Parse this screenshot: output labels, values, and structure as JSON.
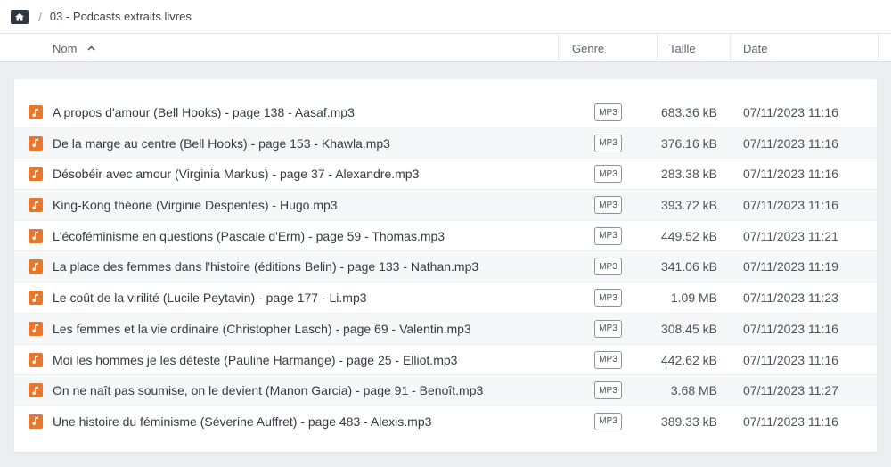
{
  "breadcrumb": {
    "home_icon": "home-folder-icon",
    "separator": "/",
    "current": "03 - Podcasts extraits livres"
  },
  "columns": {
    "name": "Nom",
    "sort_indicator": "^",
    "genre": "Genre",
    "size": "Taille",
    "date": "Date"
  },
  "colors": {
    "audio_icon": "#e8772e",
    "background": "#eceef1"
  },
  "files": [
    {
      "name": "A propos d'amour (Bell Hooks) - page 138 - Aasaf.mp3",
      "type": "MP3",
      "size": "683.36 kB",
      "date": "07/11/2023 11:16"
    },
    {
      "name": "De la marge au centre (Bell Hooks) - page 153 - Khawla.mp3",
      "type": "MP3",
      "size": "376.16 kB",
      "date": "07/11/2023 11:16"
    },
    {
      "name": "Désobéir avec amour (Virginia Markus) - page 37 - Alexandre.mp3",
      "type": "MP3",
      "size": "283.38 kB",
      "date": "07/11/2023 11:16"
    },
    {
      "name": "King-Kong théorie (Virginie Despentes) - Hugo.mp3",
      "type": "MP3",
      "size": "393.72 kB",
      "date": "07/11/2023 11:16"
    },
    {
      "name": "L'écoféminisme en questions (Pascale d'Erm) - page 59 - Thomas.mp3",
      "type": "MP3",
      "size": "449.52 kB",
      "date": "07/11/2023 11:21"
    },
    {
      "name": "La place des femmes dans l'histoire (éditions Belin) - page 133 - Nathan.mp3",
      "type": "MP3",
      "size": "341.06 kB",
      "date": "07/11/2023 11:19"
    },
    {
      "name": "Le coût de la virilité (Lucile Peytavin) - page 177 - Li.mp3",
      "type": "MP3",
      "size": "1.09 MB",
      "date": "07/11/2023 11:23"
    },
    {
      "name": "Les femmes et la vie ordinaire (Christopher Lasch) - page 69 - Valentin.mp3",
      "type": "MP3",
      "size": "308.45 kB",
      "date": "07/11/2023 11:16"
    },
    {
      "name": "Moi les hommes je les déteste (Pauline Harmange) - page 25 - Elliot.mp3",
      "type": "MP3",
      "size": "442.62 kB",
      "date": "07/11/2023 11:16"
    },
    {
      "name": "On ne naît pas soumise, on le devient (Manon Garcia) - page 91 - Benoît.mp3",
      "type": "MP3",
      "size": "3.68 MB",
      "date": "07/11/2023 11:27"
    },
    {
      "name": "Une histoire du féminisme (Séverine Auffret) - page 483 - Alexis.mp3",
      "type": "MP3",
      "size": "389.33 kB",
      "date": "07/11/2023 11:16"
    }
  ]
}
